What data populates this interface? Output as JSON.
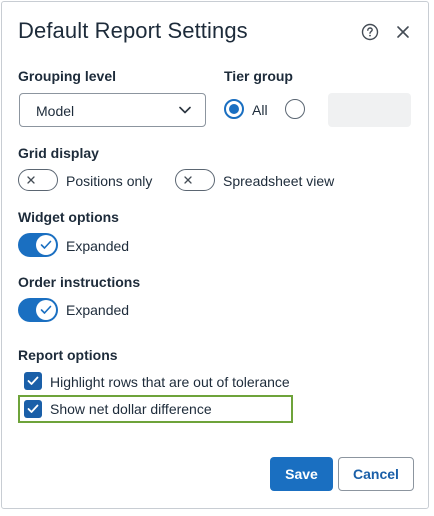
{
  "dialog": {
    "title": "Default Report Settings",
    "help_icon": "question-circle-icon",
    "close_icon": "close-icon"
  },
  "grouping": {
    "label": "Grouping level",
    "selected": "Model"
  },
  "tier_group": {
    "label": "Tier group",
    "options": [
      {
        "label": "All",
        "selected": true
      },
      {
        "label": "",
        "selected": false
      }
    ]
  },
  "grid_display": {
    "label": "Grid display",
    "options": [
      {
        "label": "Positions only",
        "on": false
      },
      {
        "label": "Spreadsheet view",
        "on": false
      }
    ]
  },
  "widget_options": {
    "label": "Widget options",
    "toggle_label": "Expanded",
    "on": true
  },
  "order_instructions": {
    "label": "Order instructions",
    "toggle_label": "Expanded",
    "on": true
  },
  "report_options": {
    "label": "Report options",
    "items": [
      {
        "label": "Highlight rows that are out of tolerance",
        "checked": true
      },
      {
        "label": "Show net dollar difference",
        "checked": true
      }
    ]
  },
  "buttons": {
    "save": "Save",
    "cancel": "Cancel"
  },
  "colors": {
    "accent": "#1a6fc1",
    "highlight_border": "#6ea33a"
  }
}
